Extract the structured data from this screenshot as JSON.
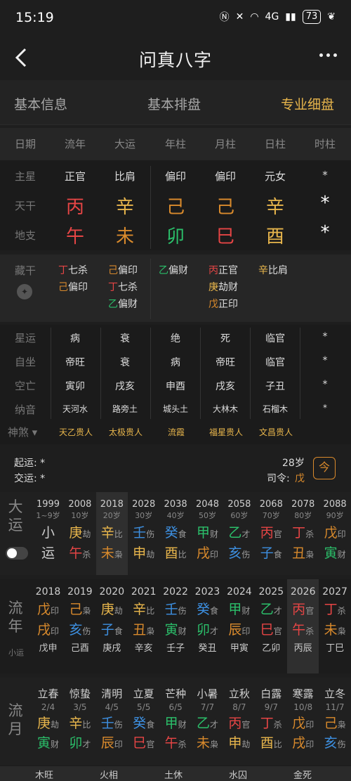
{
  "status": {
    "time": "15:19",
    "net": "4G",
    "battery": "73"
  },
  "nav": {
    "title": "问真八字"
  },
  "tabs": [
    "基本信息",
    "基本排盘",
    "专业细盘"
  ],
  "header": [
    "日期",
    "流年",
    "大运",
    "年柱",
    "月柱",
    "日柱",
    "时柱"
  ],
  "labels": {
    "zhuxing": "主星",
    "tiangan": "天干",
    "dizhi": "地支",
    "zanggan": "藏干",
    "xingyun": "星运",
    "zizuo": "自坐",
    "kongwang": "空亡",
    "nayin": "纳音",
    "shensha": "神煞"
  },
  "zhuxing": [
    "正官",
    "比肩",
    "偏印",
    "偏印",
    "元女",
    "*"
  ],
  "tiangan": [
    "丙",
    "辛",
    "己",
    "己",
    "辛",
    "*"
  ],
  "dizhi": [
    "午",
    "未",
    "卯",
    "巳",
    "酉",
    "*"
  ],
  "zanggan": [
    [
      "丁七杀",
      "己偏印"
    ],
    [
      "己偏印",
      "丁七杀",
      "乙偏财"
    ],
    [
      "乙偏财"
    ],
    [
      "丙正官",
      "庚劫财",
      "戊正印"
    ],
    [
      "辛比肩"
    ]
  ],
  "xingyun": [
    "病",
    "衰",
    "绝",
    "死",
    "临官",
    "*"
  ],
  "zizuo": [
    "帝旺",
    "衰",
    "病",
    "帝旺",
    "临官",
    "*"
  ],
  "kongwang": [
    "寅卯",
    "戌亥",
    "申酉",
    "戌亥",
    "子丑",
    "*"
  ],
  "nayin": [
    "天河水",
    "路旁土",
    "城头土",
    "大林木",
    "石榴木",
    "*"
  ],
  "shensha": [
    "天乙贵人",
    "太极贵人",
    "流霞",
    "福星贵人",
    "文昌贵人"
  ],
  "qiyun": {
    "qi": "起运: *",
    "jiao": "交运: *",
    "age": "28岁",
    "siling_label": "司令:",
    "siling_value": "戊"
  },
  "dayun_label": [
    "大",
    "运"
  ],
  "dayun": [
    {
      "yr": "1999",
      "age": "1~9岁",
      "gz": [
        "小",
        "运"
      ],
      "ss": [
        "",
        ""
      ]
    },
    {
      "yr": "2008",
      "age": "10岁",
      "gz": [
        "庚",
        "午"
      ],
      "ss": [
        "劫",
        "杀"
      ]
    },
    {
      "yr": "2018",
      "age": "20岁",
      "gz": [
        "辛",
        "未"
      ],
      "ss": [
        "比",
        "枭"
      ]
    },
    {
      "yr": "2028",
      "age": "30岁",
      "gz": [
        "壬",
        "申"
      ],
      "ss": [
        "伤",
        "劫"
      ]
    },
    {
      "yr": "2038",
      "age": "40岁",
      "gz": [
        "癸",
        "酉"
      ],
      "ss": [
        "食",
        "比"
      ]
    },
    {
      "yr": "2048",
      "age": "50岁",
      "gz": [
        "甲",
        "戌"
      ],
      "ss": [
        "财",
        "印"
      ]
    },
    {
      "yr": "2058",
      "age": "60岁",
      "gz": [
        "乙",
        "亥"
      ],
      "ss": [
        "才",
        "伤"
      ]
    },
    {
      "yr": "2068",
      "age": "70岁",
      "gz": [
        "丙",
        "子"
      ],
      "ss": [
        "官",
        "食"
      ]
    },
    {
      "yr": "2078",
      "age": "80岁",
      "gz": [
        "丁",
        "丑"
      ],
      "ss": [
        "杀",
        "枭"
      ]
    },
    {
      "yr": "2088",
      "age": "90岁",
      "gz": [
        "戊",
        "寅"
      ],
      "ss": [
        "印",
        "财"
      ]
    }
  ],
  "liunian_label": [
    "流",
    "年"
  ],
  "liunian_sub": "小运",
  "liunian": [
    {
      "yr": "2018",
      "gz": [
        "戊",
        "戌"
      ],
      "ss": [
        "印",
        "印"
      ],
      "xy": "戊申"
    },
    {
      "yr": "2019",
      "gz": [
        "己",
        "亥"
      ],
      "ss": [
        "枭",
        "伤"
      ],
      "xy": "己酉"
    },
    {
      "yr": "2020",
      "gz": [
        "庚",
        "子"
      ],
      "ss": [
        "劫",
        "食"
      ],
      "xy": "庚戌"
    },
    {
      "yr": "2021",
      "gz": [
        "辛",
        "丑"
      ],
      "ss": [
        "比",
        "枭"
      ],
      "xy": "辛亥"
    },
    {
      "yr": "2022",
      "gz": [
        "壬",
        "寅"
      ],
      "ss": [
        "伤",
        "财"
      ],
      "xy": "壬子"
    },
    {
      "yr": "2023",
      "gz": [
        "癸",
        "卯"
      ],
      "ss": [
        "食",
        "才"
      ],
      "xy": "癸丑"
    },
    {
      "yr": "2024",
      "gz": [
        "甲",
        "辰"
      ],
      "ss": [
        "财",
        "印"
      ],
      "xy": "甲寅"
    },
    {
      "yr": "2025",
      "gz": [
        "乙",
        "巳"
      ],
      "ss": [
        "才",
        "官"
      ],
      "xy": "乙卯"
    },
    {
      "yr": "2026",
      "gz": [
        "丙",
        "午"
      ],
      "ss": [
        "官",
        "杀"
      ],
      "xy": "丙辰"
    },
    {
      "yr": "2027",
      "gz": [
        "丁",
        "未"
      ],
      "ss": [
        "杀",
        "枭"
      ],
      "xy": "丁巳"
    }
  ],
  "liuyue_label": [
    "流",
    "月"
  ],
  "liuyue": [
    {
      "jq": "立春",
      "date": "2/4",
      "gz": [
        "庚",
        "寅"
      ],
      "ss": [
        "劫",
        "财"
      ]
    },
    {
      "jq": "惊蛰",
      "date": "3/5",
      "gz": [
        "辛",
        "卯"
      ],
      "ss": [
        "比",
        "才"
      ]
    },
    {
      "jq": "清明",
      "date": "4/5",
      "gz": [
        "壬",
        "辰"
      ],
      "ss": [
        "伤",
        "印"
      ]
    },
    {
      "jq": "立夏",
      "date": "5/5",
      "gz": [
        "癸",
        "巳"
      ],
      "ss": [
        "食",
        "官"
      ]
    },
    {
      "jq": "芒种",
      "date": "6/5",
      "gz": [
        "甲",
        "午"
      ],
      "ss": [
        "财",
        "杀"
      ]
    },
    {
      "jq": "小暑",
      "date": "7/7",
      "gz": [
        "乙",
        "未"
      ],
      "ss": [
        "才",
        "枭"
      ]
    },
    {
      "jq": "立秋",
      "date": "8/7",
      "gz": [
        "丙",
        "申"
      ],
      "ss": [
        "官",
        "劫"
      ]
    },
    {
      "jq": "白露",
      "date": "9/7",
      "gz": [
        "丁",
        "酉"
      ],
      "ss": [
        "杀",
        "比"
      ]
    },
    {
      "jq": "寒露",
      "date": "10/8",
      "gz": [
        "戊",
        "戌"
      ],
      "ss": [
        "印",
        "印"
      ]
    },
    {
      "jq": "立冬",
      "date": "11/7",
      "gz": [
        "己",
        "亥"
      ],
      "ss": [
        "枭",
        "伤"
      ]
    }
  ],
  "bottom": [
    "木旺",
    "火相",
    "土休",
    "水囚",
    "金死"
  ],
  "colors": {
    "fire": "#e64545",
    "metal": "#e8b64c",
    "earth": "#d98a2c",
    "wood": "#2bbf6a",
    "water": "#3d8fe0",
    "gold": "#e8b64c"
  }
}
